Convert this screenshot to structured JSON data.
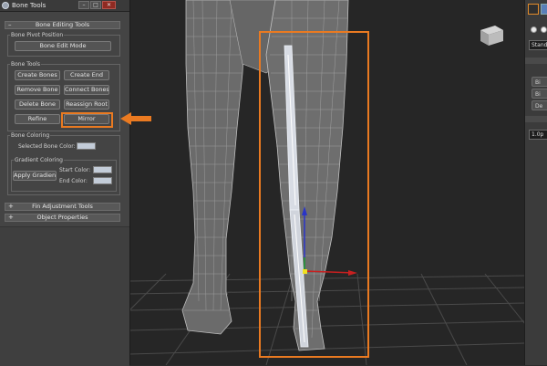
{
  "window": {
    "title": "Bone Tools",
    "minimize_label": "–",
    "maximize_label": "□",
    "close_label": "✕"
  },
  "rollouts": {
    "bone_editing": {
      "title": "Bone Editing Tools",
      "sign": "–"
    },
    "fin_adjustment": {
      "title": "Fin Adjustment Tools",
      "sign": "+"
    },
    "object_properties": {
      "title": "Object Properties",
      "sign": "+"
    }
  },
  "bone_pivot": {
    "group_label": "Bone Pivot Position",
    "edit_mode_label": "Bone Edit Mode"
  },
  "bone_tools": {
    "group_label": "Bone Tools",
    "create_bones": "Create Bones",
    "create_end": "Create End",
    "remove_bone": "Remove Bone",
    "connect_bones": "Connect Bones",
    "delete_bone": "Delete Bone",
    "reassign_root": "Reassign Root",
    "refine": "Refine",
    "mirror": "Mirror"
  },
  "bone_coloring": {
    "group_label": "Bone Coloring",
    "selected_color_label": "Selected Bone Color:",
    "selected_color": "#c3ccd8",
    "gradient": {
      "group_label": "Gradient Coloring",
      "apply_label": "Apply Gradient",
      "start_label": "Start Color:",
      "end_label": "End Color:",
      "start_color": "#c3ccd8",
      "end_color": "#c3ccd8"
    }
  },
  "right_panel": {
    "dropdown_value": "Standa",
    "button_1": "Bi",
    "button_2": "Bi",
    "button_3": "De",
    "field_value": "1.0p"
  },
  "colors": {
    "highlight": "#ea7a21",
    "viewport_bg": "#262626",
    "panel_bg": "#444444"
  },
  "icons": {
    "title_icon": "bone-tools-icon",
    "arrow": "arrow-left-icon",
    "viewcube": "viewcube-icon"
  }
}
